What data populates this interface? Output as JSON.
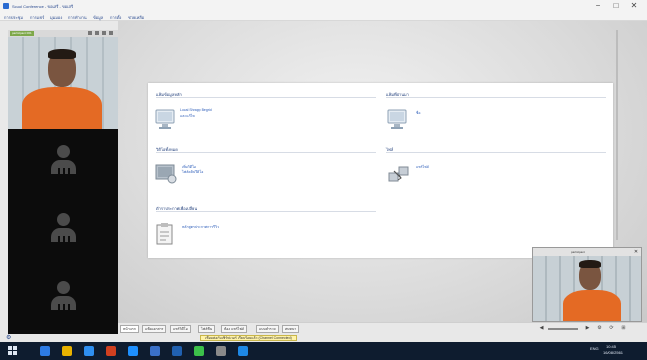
{
  "window": {
    "title": "Scuol Conference - ขอเสรี - ขอเสรี",
    "controls": [
      "−",
      "□",
      "✕"
    ]
  },
  "menubar": {
    "items": [
      "การประชุม",
      "การแชร์",
      "มุมมอง",
      "การทำงาน",
      "ข้อมูล",
      "การตั้ง",
      "ช่วยเหลือ"
    ]
  },
  "left_panel": {
    "participant_name": "participant 001"
  },
  "explorer": {
    "sections": [
      {
        "title": "แฟ้มข้อมูลหลัก",
        "items": [
          {
            "label": "Local Shrapp Begrid",
            "sublabel": "และแก้ไข"
          }
        ]
      },
      {
        "title": "แฟ้มที่ผ่านมา",
        "items": [
          {
            "label": "ชื่อ"
          }
        ]
      },
      {
        "title": "วิดีโอทั้งหมด",
        "items": [
          {
            "label": "เพิ่มวิดีโอ",
            "sublabel": "ไฟล์คลิปวีดิโอ"
          }
        ]
      },
      {
        "title": "ไฟล์",
        "items": [
          {
            "label": "แชร์ไฟล์"
          }
        ]
      },
      {
        "title": "ตำราประกาศเพื่อเปลี่ยน",
        "items": [
          {
            "label": "หลักสูตรประกาศการรีวิว"
          }
        ]
      }
    ]
  },
  "pip": {
    "title": "participant"
  },
  "bottom_tabs": [
    "หน้าแรก",
    "แฟ้มเอกสาร",
    "แชร์วิดีโอ",
    "ไฟล์ซีน",
    "ห้อง แชร์ไฟล์",
    "แบบสำรวจ",
    "สนทนา"
  ],
  "bottom_controls": [
    "◀",
    "▶",
    "⚙",
    "⟳",
    "⊞"
  ],
  "status": {
    "text": "เชื่อมต่อกับเซิร์ฟเวอร์ เรียบร้อยแล้ว (Channel Connected)"
  },
  "taskbar": {
    "time": "10:45",
    "date": "16/08/2561",
    "lang": "ENG",
    "app_colors": [
      "#2d7be5",
      "#e8b200",
      "#2f8ff0",
      "#d04020",
      "#1e90ff",
      "#3a70c8",
      "#2060b0",
      "#3cc04a",
      "#8a8a8a",
      "#1e88e5"
    ]
  }
}
